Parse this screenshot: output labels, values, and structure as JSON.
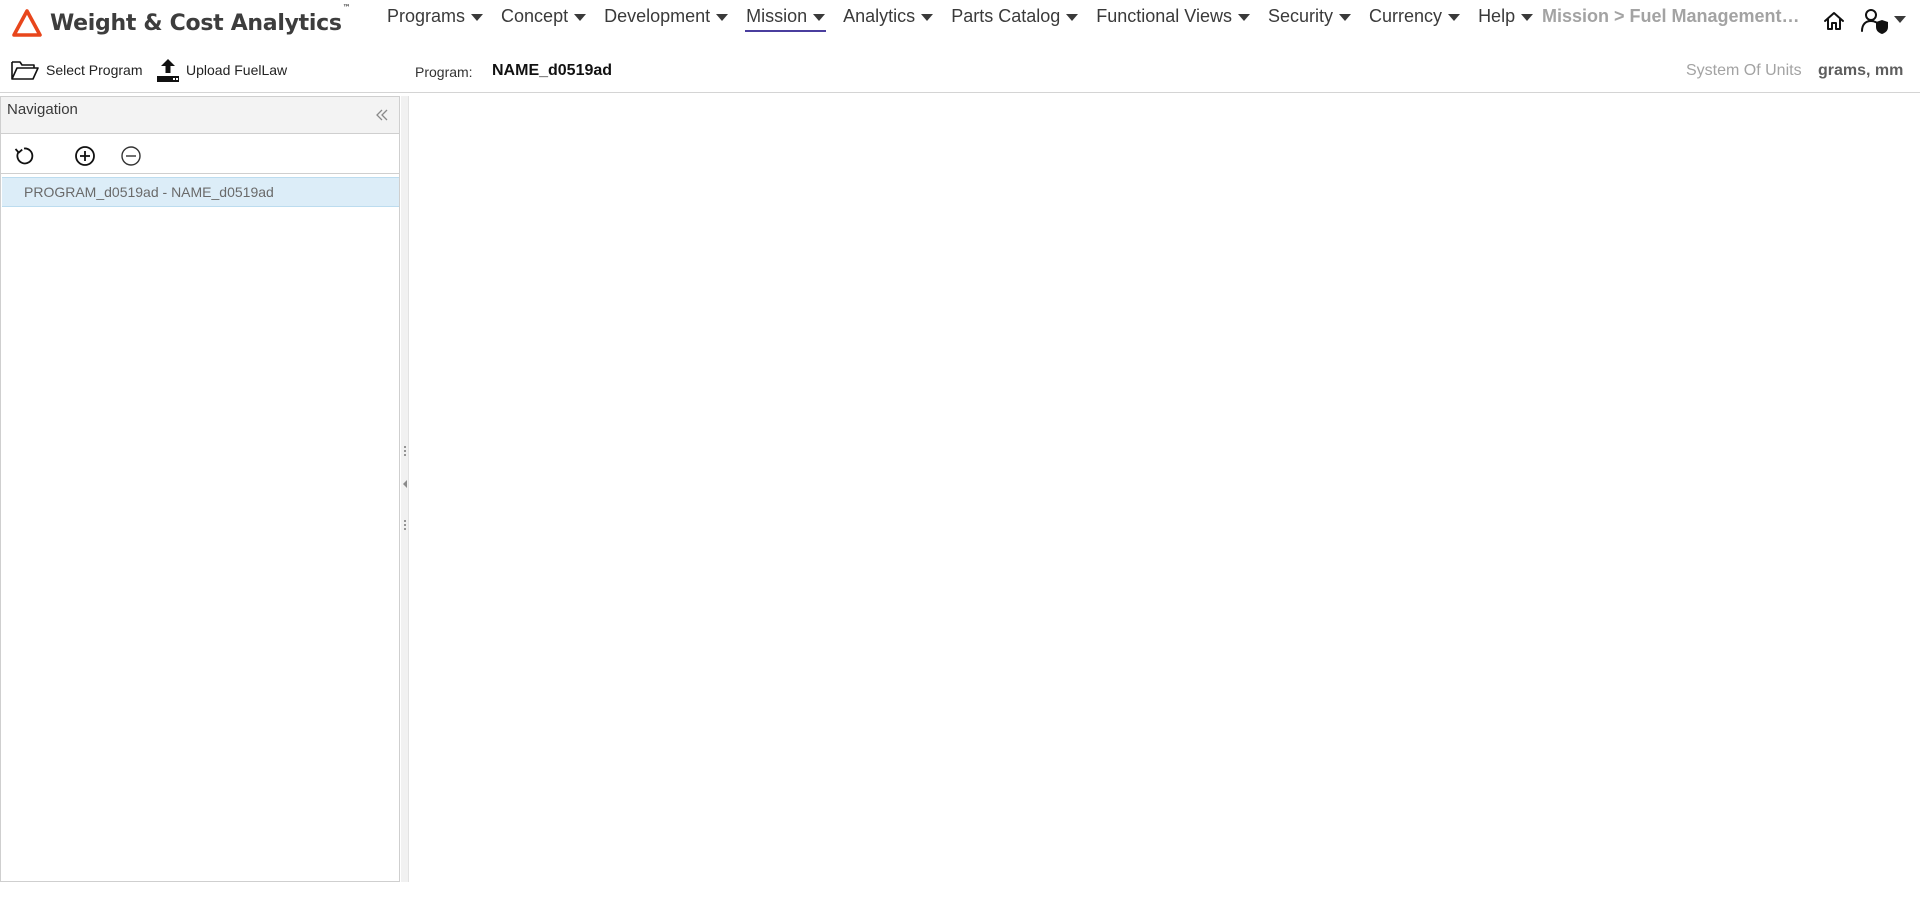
{
  "app": {
    "title": "Weight & Cost Analytics",
    "trademark": "™",
    "logo_icon": "delta-logo-icon",
    "accent_color": "#e8461c"
  },
  "menu": {
    "items": [
      {
        "label": "Programs",
        "active": false
      },
      {
        "label": "Concept",
        "active": false
      },
      {
        "label": "Development",
        "active": false
      },
      {
        "label": "Mission",
        "active": true
      },
      {
        "label": "Analytics",
        "active": false
      },
      {
        "label": "Parts Catalog",
        "active": false
      },
      {
        "label": "Functional Views",
        "active": false
      },
      {
        "label": "Security",
        "active": false
      },
      {
        "label": "Currency",
        "active": false
      },
      {
        "label": "Help",
        "active": false
      }
    ],
    "active_underline_color": "#4a3e9e"
  },
  "breadcrumb": "Mission > Fuel Management > Fuel Law",
  "header_icons": {
    "home": "home-icon",
    "user": "user-shield-icon"
  },
  "toolbar": {
    "select_program": "Select Program",
    "upload_fuellaw": "Upload FuelLaw",
    "program_label": "Program:",
    "program_value": "NAME_d0519ad",
    "units_label": "System Of Units",
    "units_value": "grams, mm"
  },
  "navigation": {
    "title": "Navigation",
    "tools": {
      "refresh": "refresh-icon",
      "expand": "plus-circle-icon",
      "collapse": "minus-circle-icon"
    },
    "tree": [
      {
        "label": "PROGRAM_d0519ad - NAME_d0519ad",
        "selected": true
      }
    ],
    "selected_color": "#dcedf8"
  }
}
